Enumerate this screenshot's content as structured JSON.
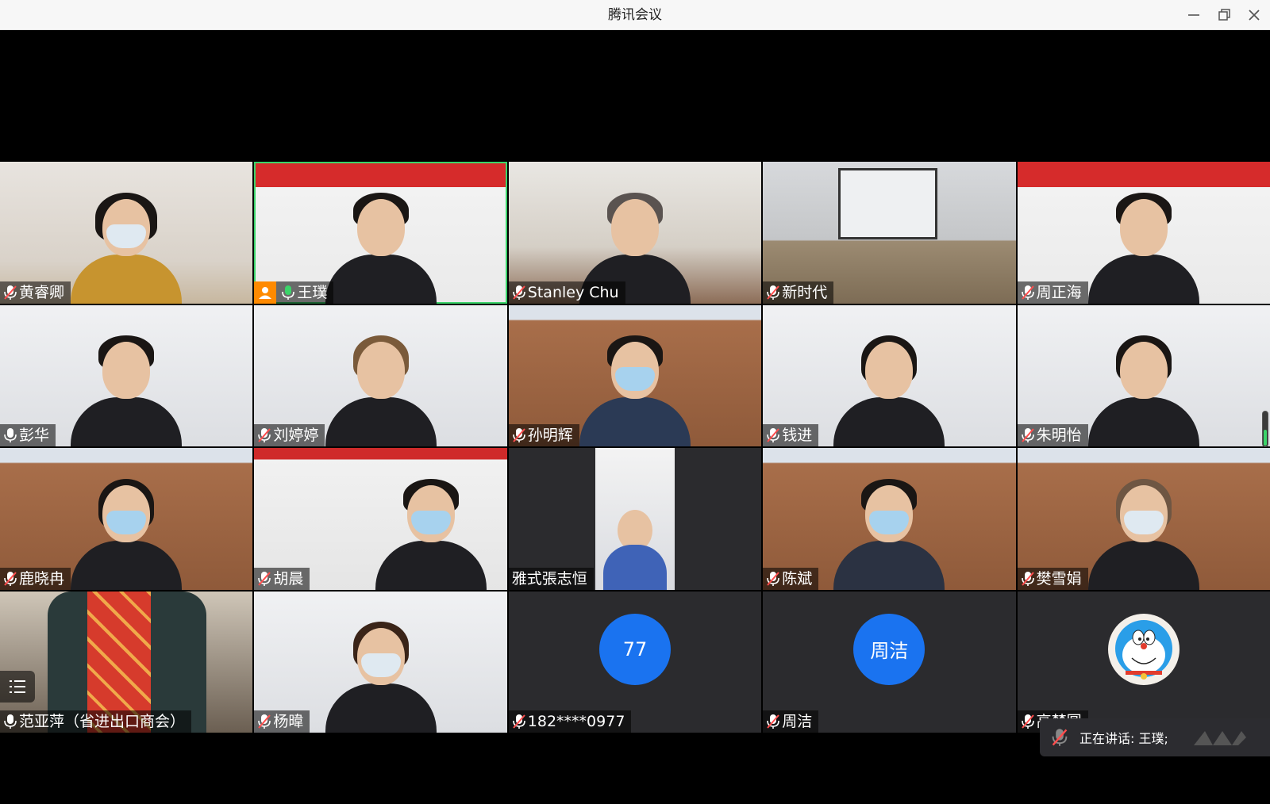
{
  "window": {
    "title": "腾讯会议"
  },
  "participants": [
    {
      "name": "黄睿卿",
      "mic": "muted",
      "video": "on"
    },
    {
      "name": "王璞",
      "mic": "active",
      "video": "on",
      "host": true
    },
    {
      "name": "Stanley Chu",
      "mic": "muted",
      "video": "on"
    },
    {
      "name": "新时代",
      "mic": "muted",
      "video": "on"
    },
    {
      "name": "周正海",
      "mic": "muted",
      "video": "on"
    },
    {
      "name": "彭华",
      "mic": "on",
      "video": "on"
    },
    {
      "name": "刘婷婷",
      "mic": "muted",
      "video": "on"
    },
    {
      "name": "孙明辉",
      "mic": "muted",
      "video": "on"
    },
    {
      "name": "钱进",
      "mic": "muted",
      "video": "on"
    },
    {
      "name": "朱明怡",
      "mic": "muted",
      "video": "on"
    },
    {
      "name": "鹿晓冉",
      "mic": "muted",
      "video": "on"
    },
    {
      "name": "胡晨",
      "mic": "muted",
      "video": "on"
    },
    {
      "name": "雅式張志恒",
      "mic": "none",
      "video": "on"
    },
    {
      "name": "陈斌",
      "mic": "muted",
      "video": "on"
    },
    {
      "name": "樊雪娟",
      "mic": "muted",
      "video": "on"
    },
    {
      "name": "范亚萍（省进出口商会）",
      "mic": "on",
      "video": "on"
    },
    {
      "name": "杨暐",
      "mic": "muted",
      "video": "on"
    },
    {
      "name": "182****0977",
      "mic": "muted",
      "video": "off",
      "avatar_text": "77"
    },
    {
      "name": "周洁",
      "mic": "muted",
      "video": "off",
      "avatar_text": "周洁"
    },
    {
      "name": "高梦圆",
      "mic": "muted",
      "video": "off",
      "avatar_icon": "doraemon-avatar-icon"
    }
  ],
  "speaking_indicator": {
    "text": "正在讲话: 王璞;"
  },
  "colors": {
    "avatar_blue": "#1a73f0",
    "host_badge": "#ff8a00",
    "mic_active": "#3bd46a",
    "mic_muted_slash": "#ff4d4d"
  }
}
